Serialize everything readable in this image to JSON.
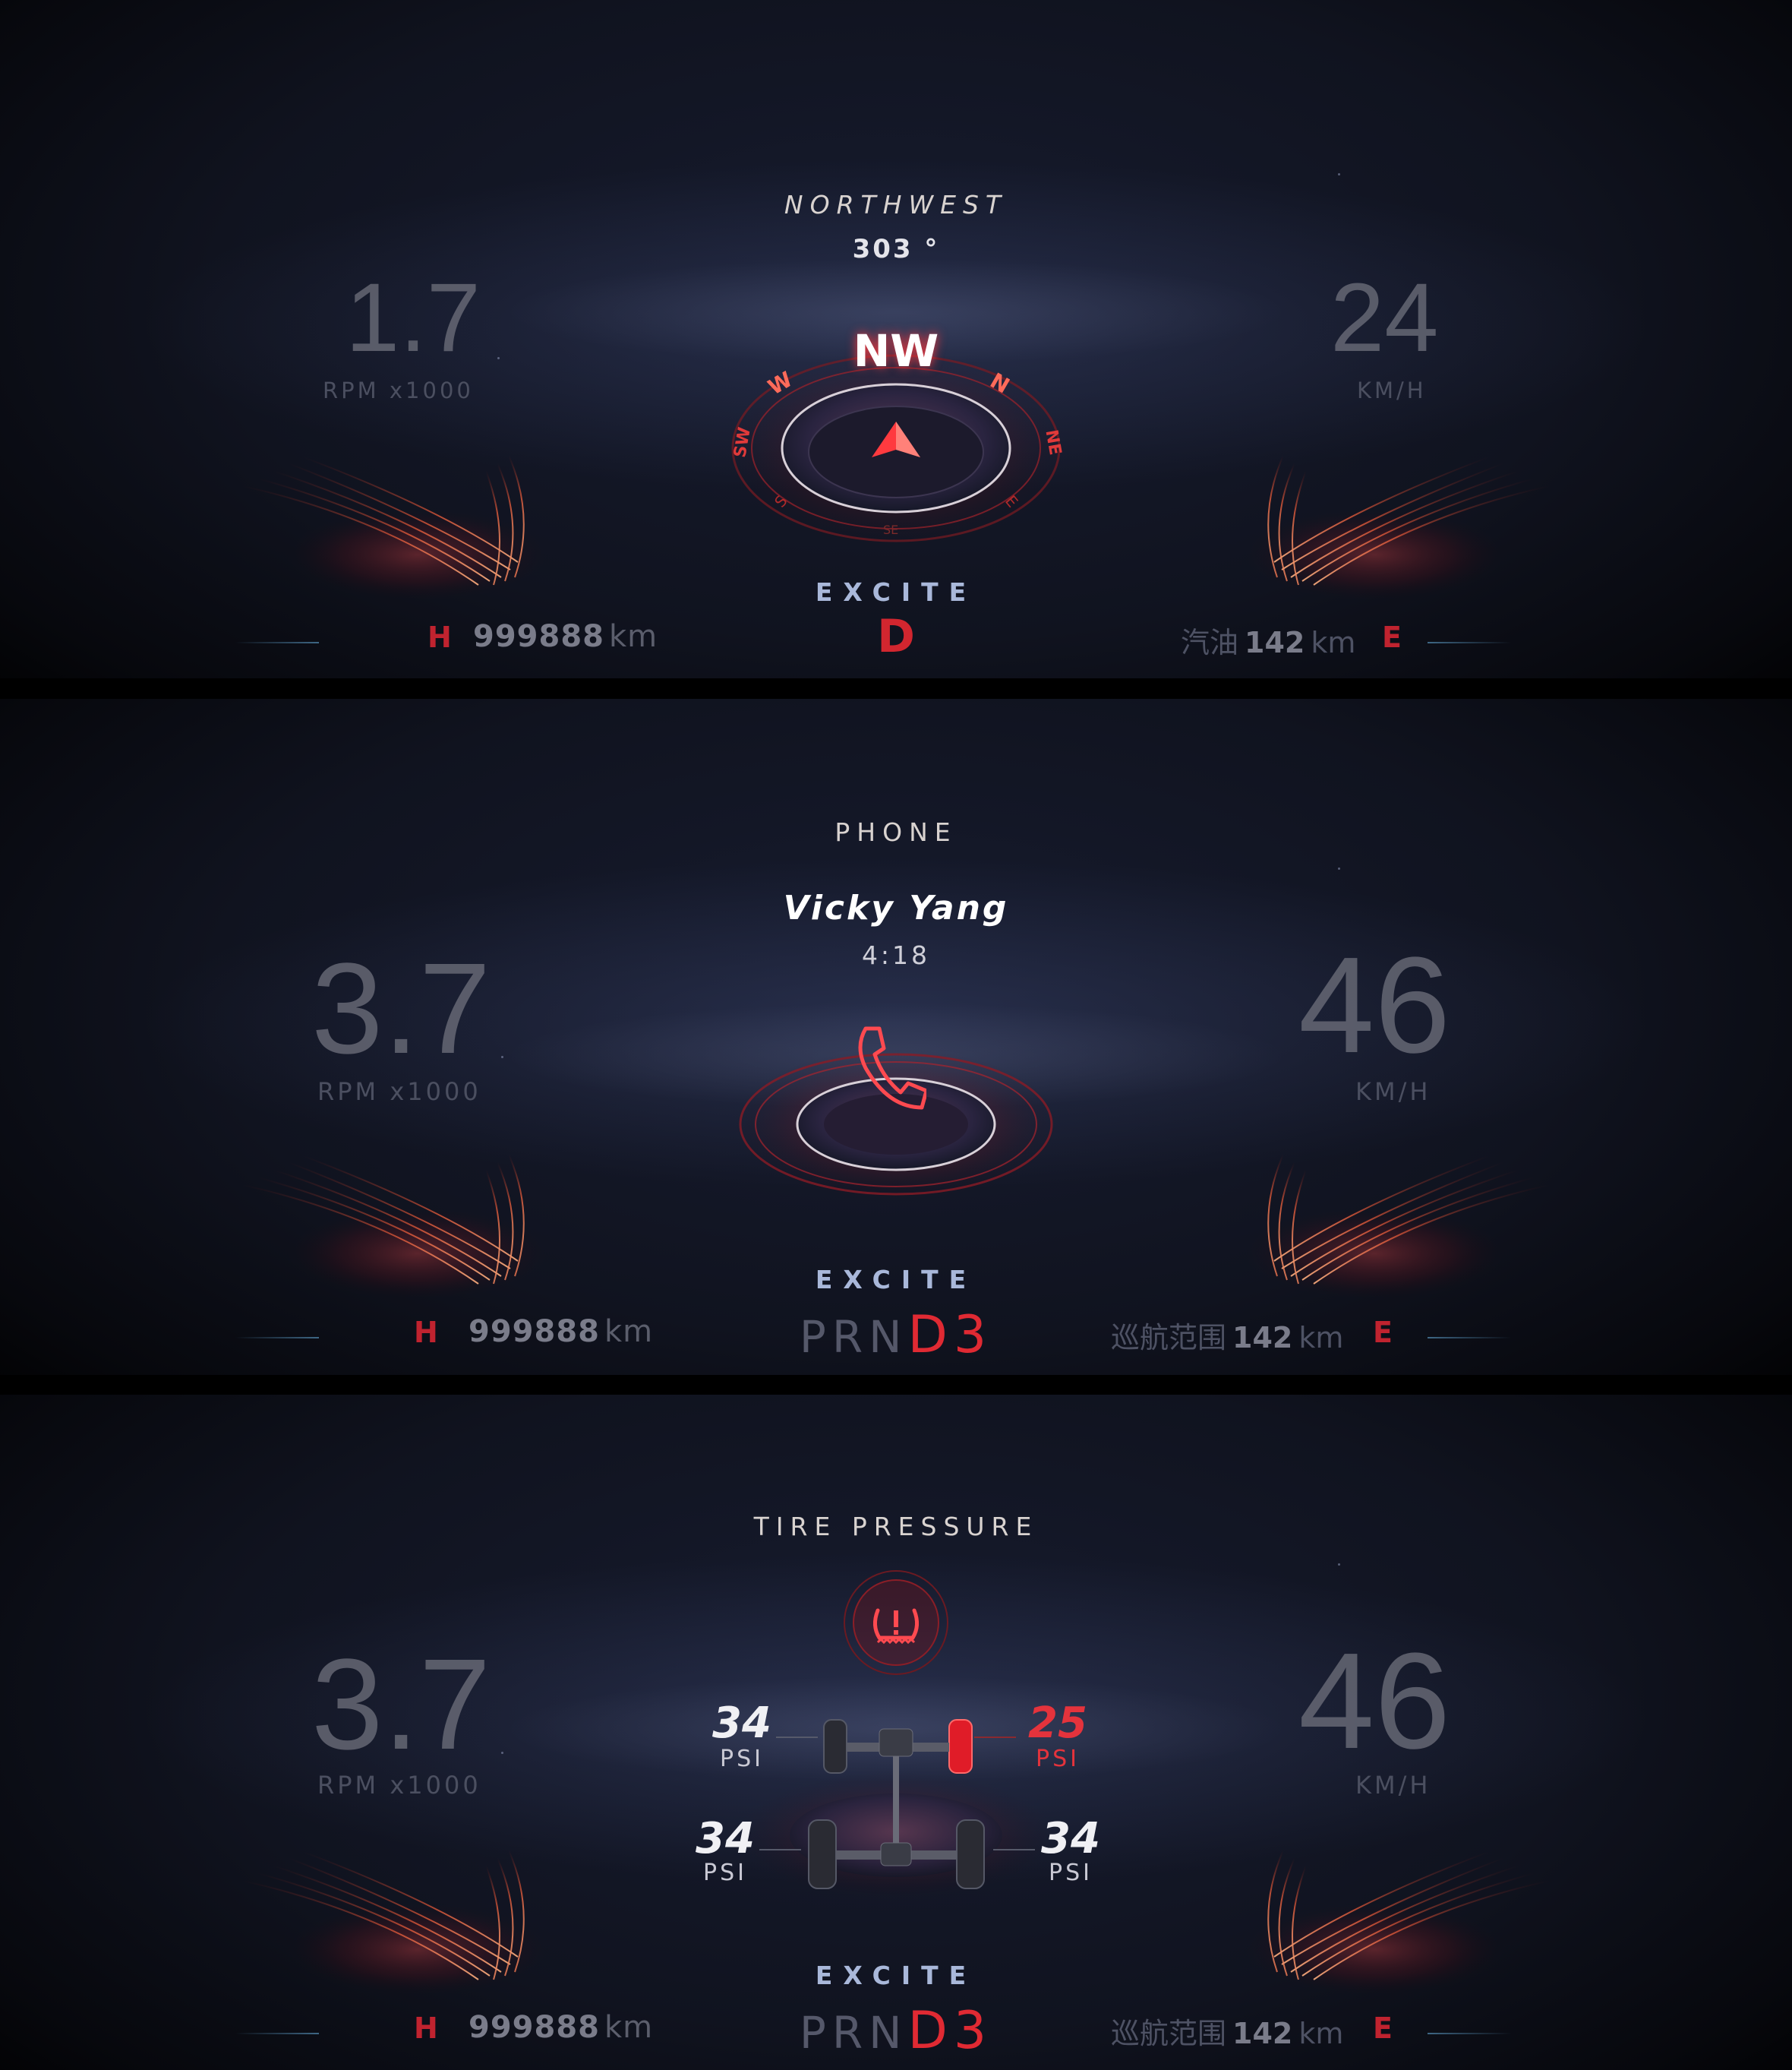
{
  "panels": [
    {
      "title": "NORTHWEST",
      "subtitle": "303 °",
      "rpm": {
        "value": "1.7",
        "unit": "RPM x1000"
      },
      "speed": {
        "value": "24",
        "unit": "KM/H"
      },
      "compass": {
        "heading": "NW",
        "labels": [
          "W",
          "N",
          "SW",
          "NE",
          "S",
          "E",
          "SE"
        ]
      },
      "mode": "EXCITE",
      "gear": "D",
      "odometer": {
        "h": "H",
        "value": "999888",
        "unit": "km"
      },
      "range": {
        "label": "汽油",
        "value": "142",
        "unit": "km",
        "e": "E"
      }
    },
    {
      "title": "PHONE",
      "caller": "Vicky Yang",
      "duration": "4:18",
      "rpm": {
        "value": "3.7",
        "unit": "RPM x1000"
      },
      "speed": {
        "value": "46",
        "unit": "KM/H"
      },
      "mode": "EXCITE",
      "gears_inactive": "PRN",
      "gear_active": "D3",
      "odometer": {
        "h": "H",
        "value": "999888",
        "unit": "km"
      },
      "range": {
        "label": "巡航范围",
        "value": "142",
        "unit": "km",
        "e": "E"
      }
    },
    {
      "title": "TIRE PRESSURE",
      "rpm": {
        "value": "3.7",
        "unit": "RPM x1000"
      },
      "speed": {
        "value": "46",
        "unit": "KM/H"
      },
      "tires": {
        "front_left": {
          "value": "34",
          "unit": "PSI"
        },
        "front_right": {
          "value": "25",
          "unit": "PSI"
        },
        "rear_left": {
          "value": "34",
          "unit": "PSI"
        },
        "rear_right": {
          "value": "34",
          "unit": "PSI"
        }
      },
      "mode": "EXCITE",
      "gears_inactive": "PRN",
      "gear_active": "D3",
      "odometer": {
        "h": "H",
        "value": "999888",
        "unit": "km"
      },
      "range": {
        "label": "巡航范围",
        "value": "142",
        "unit": "km",
        "e": "E"
      }
    }
  ],
  "colors": {
    "accent_red": "#e02a33",
    "mode_blue": "#a9b8da",
    "background": "#10131f"
  }
}
